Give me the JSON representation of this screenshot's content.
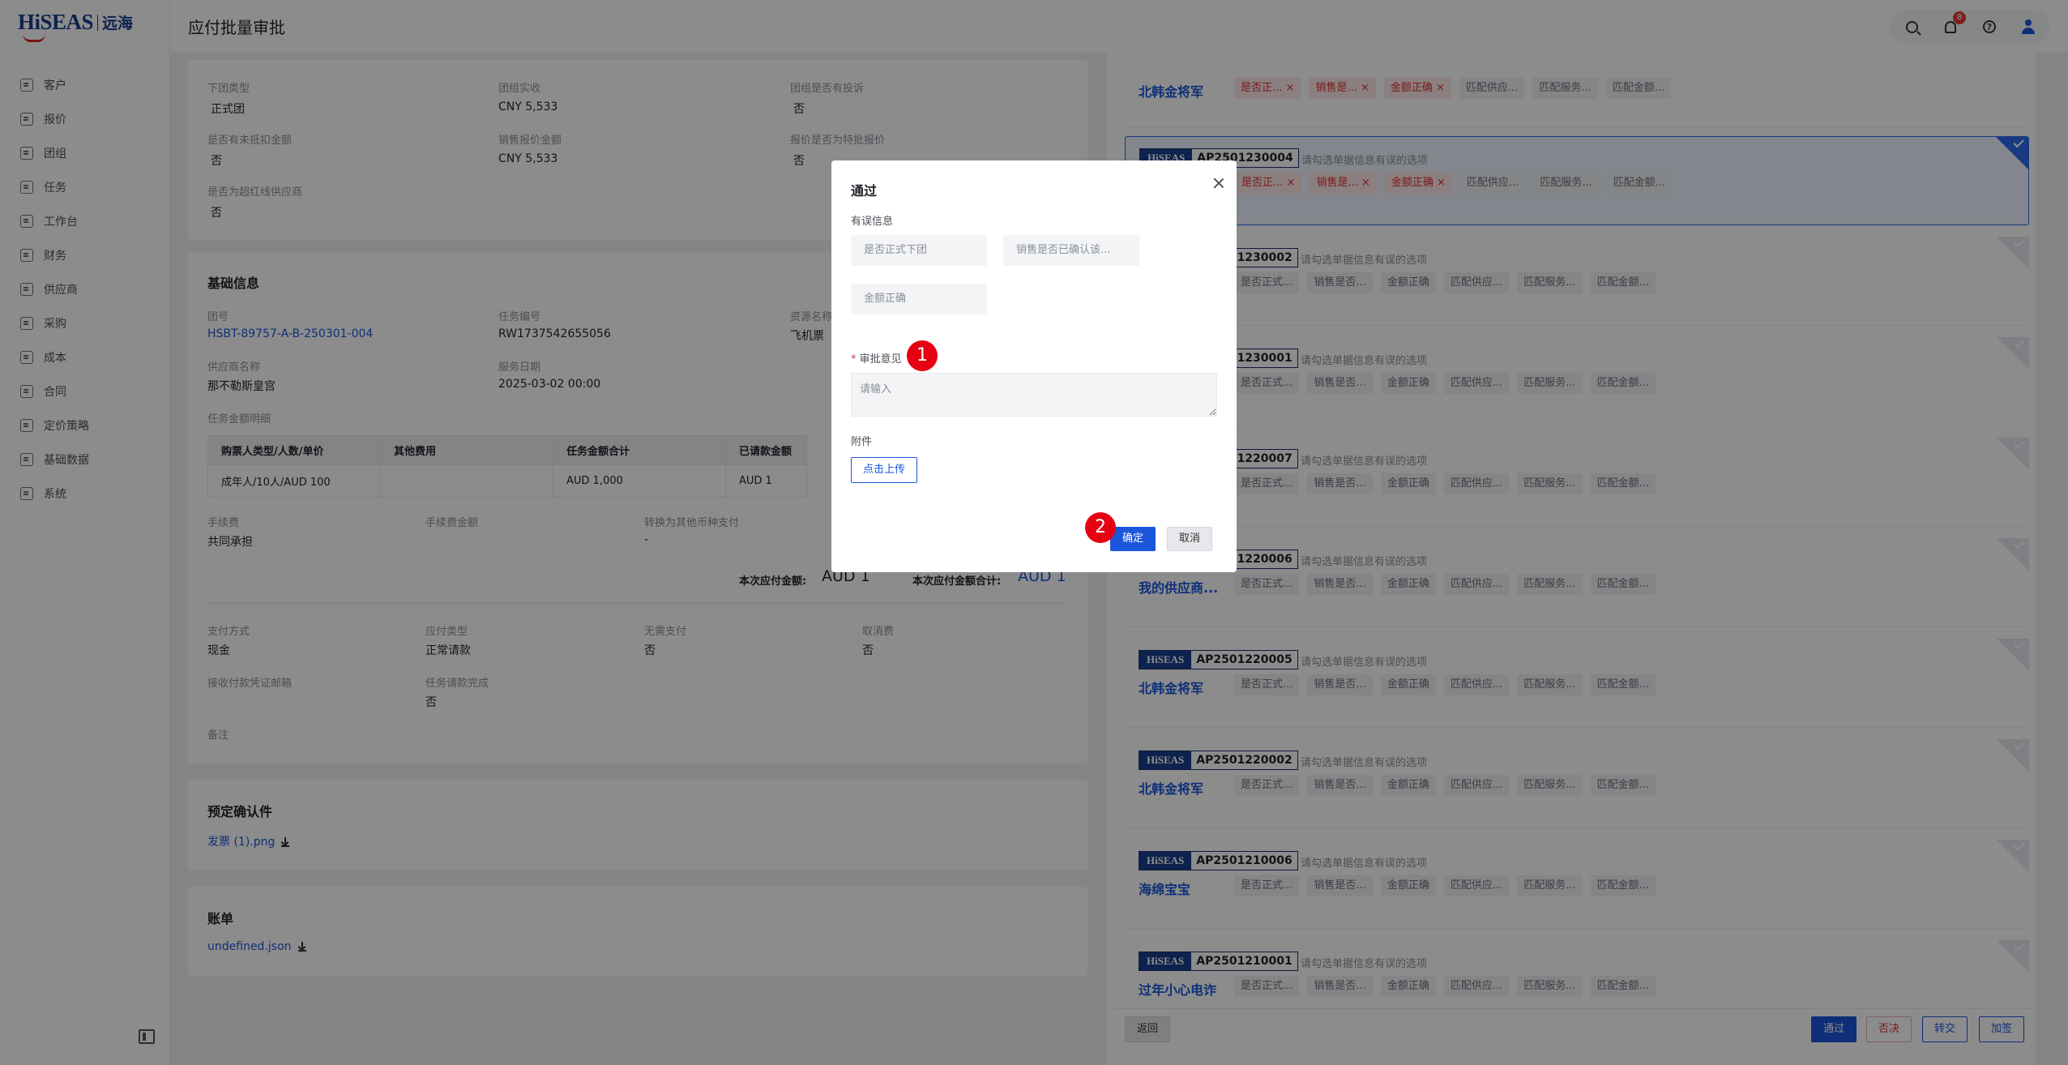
{
  "app": {
    "logo_text": "HiSEAS",
    "logo_cn": "远海",
    "page_title": "应付批量审批",
    "notification_count": "8"
  },
  "sidebar": {
    "items": [
      {
        "label": "客户",
        "icon": "customer-icon"
      },
      {
        "label": "报价",
        "icon": "quote-icon"
      },
      {
        "label": "团组",
        "icon": "group-icon"
      },
      {
        "label": "任务",
        "icon": "task-icon"
      },
      {
        "label": "工作台",
        "icon": "workbench-icon"
      },
      {
        "label": "财务",
        "icon": "finance-icon"
      },
      {
        "label": "供应商",
        "icon": "supplier-icon"
      },
      {
        "label": "采购",
        "icon": "purchase-icon"
      },
      {
        "label": "成本",
        "icon": "cost-icon"
      },
      {
        "label": "合同",
        "icon": "contract-icon"
      },
      {
        "label": "定价策略",
        "icon": "pricing-icon"
      },
      {
        "label": "基础数据",
        "icon": "basedata-icon"
      },
      {
        "label": "系统",
        "icon": "system-icon"
      }
    ]
  },
  "summary": {
    "group_type_label": "下团类型",
    "group_type_value": "正式团",
    "group_income_label": "团组实收",
    "group_income_value": "CNY 5,533",
    "complaint_label": "团组是否有投诉",
    "complaint_value": "否",
    "unoffset_label": "是否有未抵扣金额",
    "unoffset_value": "否",
    "sales_quote_label": "销售报价金额",
    "sales_quote_value": "CNY 5,533",
    "special_quote_label": "报价是否为特批报价",
    "special_quote_value": "否",
    "redline_label": "是否为超红线供应商",
    "redline_value": "否"
  },
  "basic": {
    "title": "基础信息",
    "group_no_label": "团号",
    "group_no_value": "HSBT-89757-A-B-250301-004",
    "task_no_label": "任务编号",
    "task_no_value": "RW1737542655056",
    "resource_label": "资源名称",
    "resource_value": "飞机票",
    "supplier_label": "供应商名称",
    "supplier_value": "那不勒斯皇宫",
    "service_date_label": "服务日期",
    "service_date_value": "2025-03-02 00:00",
    "detail_label": "任务金额明细",
    "table_headers": [
      "购票人类型/人数/单价",
      "其他费用",
      "任务金额合计",
      "已请款金额"
    ],
    "table_row": [
      "成年人/10人/AUD 100",
      "",
      "AUD 1,000",
      "AUD 1"
    ],
    "fee_label": "手续费",
    "fee_value": "共同承担",
    "fee_amount_label": "手续费金额",
    "fee_amount_value": "",
    "convert_label": "转换为其他币种支付",
    "convert_value": "-",
    "payable_label": "本次应付金额:",
    "payable_value": "AUD 1",
    "payable_total_label": "本次应付金额合计:",
    "payable_total_value": "AUD 1",
    "pay_method_label": "支付方式",
    "pay_method_value": "现金",
    "payable_type_label": "应付类型",
    "payable_type_value": "正常请款",
    "no_pay_label": "无需支付",
    "no_pay_value": "否",
    "cancel_fee_label": "取消费",
    "cancel_fee_value": "否",
    "receipt_email_label": "接收付款凭证邮箱",
    "task_done_label": "任务请款完成",
    "task_done_value": "否",
    "remark_label": "备注"
  },
  "confirm": {
    "title": "预定确认件",
    "file": "发票 (1).png"
  },
  "bill": {
    "title": "账单",
    "file": "undefined.json"
  },
  "ap_list": [
    {
      "no": "",
      "name": "北韩金将军",
      "hint": "",
      "chips": [
        {
          "t": "是否正...",
          "err": true
        },
        {
          "t": "销售是...",
          "err": true
        },
        {
          "t": "金额正确",
          "err": true
        },
        {
          "t": "匹配供应...",
          "err": false
        },
        {
          "t": "匹配服务...",
          "err": false
        },
        {
          "t": "匹配金额...",
          "err": false
        }
      ]
    },
    {
      "no": "AP2501230004",
      "name": "",
      "hint": "请勾选单据信息有误的选项",
      "chips": [
        {
          "t": "是否正...",
          "err": true
        },
        {
          "t": "销售是...",
          "err": true
        },
        {
          "t": "金额正确",
          "err": true
        },
        {
          "t": "匹配供应...",
          "err": false
        },
        {
          "t": "匹配服务...",
          "err": false
        },
        {
          "t": "匹配金额...",
          "err": false
        }
      ]
    },
    {
      "no": "AP2501230002",
      "name": "",
      "hint": "请勾选单据信息有误的选项",
      "chips": [
        {
          "t": "是否正式...",
          "err": false
        },
        {
          "t": "销售是否...",
          "err": false
        },
        {
          "t": "金额正确",
          "err": false
        },
        {
          "t": "匹配供应...",
          "err": false
        },
        {
          "t": "匹配服务...",
          "err": false
        },
        {
          "t": "匹配金额...",
          "err": false
        }
      ]
    },
    {
      "no": "AP2501230001",
      "name": "",
      "hint": "请勾选单据信息有误的选项",
      "chips": [
        {
          "t": "是否正式...",
          "err": false
        },
        {
          "t": "销售是否...",
          "err": false
        },
        {
          "t": "金额正确",
          "err": false
        },
        {
          "t": "匹配供应...",
          "err": false
        },
        {
          "t": "匹配服务...",
          "err": false
        },
        {
          "t": "匹配金额...",
          "err": false
        }
      ]
    },
    {
      "no": "AP2501220007",
      "name": "",
      "hint": "请勾选单据信息有误的选项",
      "chips": [
        {
          "t": "是否正式...",
          "err": false
        },
        {
          "t": "销售是否...",
          "err": false
        },
        {
          "t": "金额正确",
          "err": false
        },
        {
          "t": "匹配供应...",
          "err": false
        },
        {
          "t": "匹配服务...",
          "err": false
        },
        {
          "t": "匹配金额...",
          "err": false
        }
      ]
    },
    {
      "no": "AP2501220006",
      "name": "我的供应商...",
      "hint": "请勾选单据信息有误的选项",
      "chips": [
        {
          "t": "是否正式...",
          "err": false
        },
        {
          "t": "销售是否...",
          "err": false
        },
        {
          "t": "金额正确",
          "err": false
        },
        {
          "t": "匹配供应...",
          "err": false
        },
        {
          "t": "匹配服务...",
          "err": false
        },
        {
          "t": "匹配金额...",
          "err": false
        }
      ]
    },
    {
      "no": "AP2501220005",
      "name": "北韩金将军",
      "hint": "请勾选单据信息有误的选项",
      "chips": [
        {
          "t": "是否正式...",
          "err": false
        },
        {
          "t": "销售是否...",
          "err": false
        },
        {
          "t": "金额正确",
          "err": false
        },
        {
          "t": "匹配供应...",
          "err": false
        },
        {
          "t": "匹配服务...",
          "err": false
        },
        {
          "t": "匹配金额...",
          "err": false
        }
      ]
    },
    {
      "no": "AP2501220002",
      "name": "北韩金将军",
      "hint": "请勾选单据信息有误的选项",
      "chips": [
        {
          "t": "是否正式...",
          "err": false
        },
        {
          "t": "销售是否...",
          "err": false
        },
        {
          "t": "金额正确",
          "err": false
        },
        {
          "t": "匹配供应...",
          "err": false
        },
        {
          "t": "匹配服务...",
          "err": false
        },
        {
          "t": "匹配金额...",
          "err": false
        }
      ]
    },
    {
      "no": "AP2501210006",
      "name": "海绵宝宝",
      "hint": "请勾选单据信息有误的选项",
      "chips": [
        {
          "t": "是否正式...",
          "err": false
        },
        {
          "t": "销售是否...",
          "err": false
        },
        {
          "t": "金额正确",
          "err": false
        },
        {
          "t": "匹配供应...",
          "err": false
        },
        {
          "t": "匹配服务...",
          "err": false
        },
        {
          "t": "匹配金额...",
          "err": false
        }
      ]
    },
    {
      "no": "AP2501210001",
      "name": "过年小心电诈",
      "hint": "请勾选单据信息有误的选项",
      "chips": [
        {
          "t": "是否正式...",
          "err": false
        },
        {
          "t": "销售是否...",
          "err": false
        },
        {
          "t": "金额正确",
          "err": false
        },
        {
          "t": "匹配供应...",
          "err": false
        },
        {
          "t": "匹配服务...",
          "err": false
        },
        {
          "t": "匹配金额...",
          "err": false
        }
      ]
    }
  ],
  "bottom": {
    "back": "返回",
    "approve": "通过",
    "reject": "否决",
    "transfer": "转交",
    "countersign": "加签"
  },
  "modal": {
    "title": "通过",
    "error_info_label": "有误信息",
    "options": [
      "是否正式下团",
      "销售是否已确认该...",
      "金额正确"
    ],
    "opinion_label": "审批意见",
    "opinion_placeholder": "请输入",
    "attachment_label": "附件",
    "upload_label": "点击上传",
    "confirm_label": "确定",
    "cancel_label": "取消"
  },
  "steps": [
    "1",
    "2"
  ],
  "colors": {
    "brand": "#1b3f8f",
    "primary": "#1a56db",
    "danger": "#e03131",
    "step": "#e60012"
  }
}
